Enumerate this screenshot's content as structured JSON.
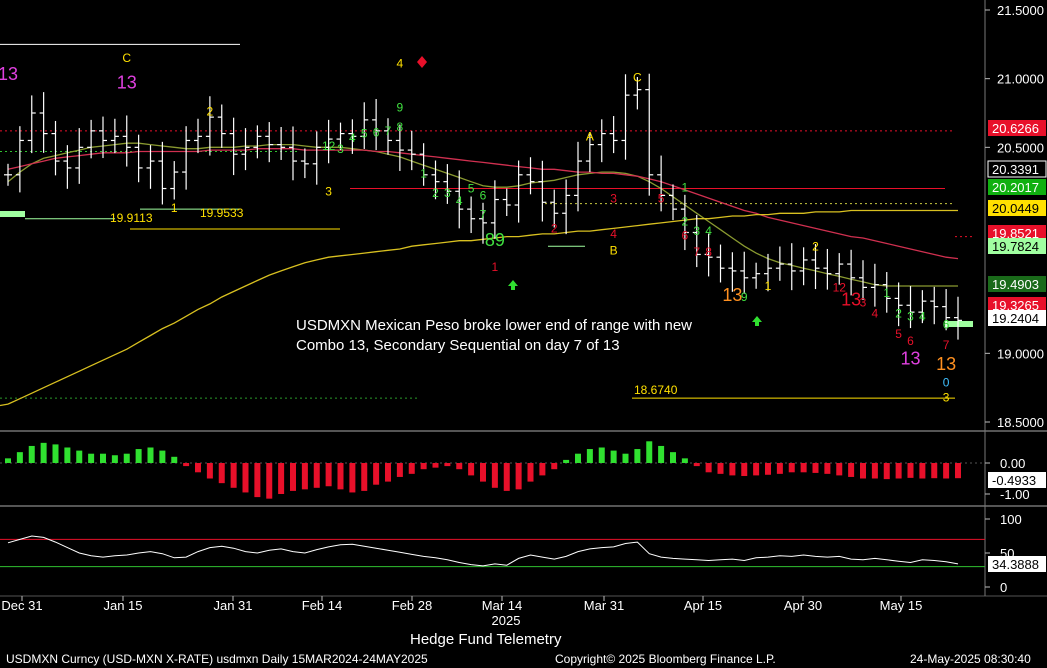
{
  "title": "Hedge Fund Telemetry",
  "footer": {
    "left": "USDMXN Curncy (USD-MXN X-RATE) usdmxn  Daily 15MAR2024-24MAY2025",
    "center": "Copyright© 2025 Bloomberg Finance L.P.",
    "right": "24-May-2025 08:30:40"
  },
  "annotation": {
    "line1": "USDMXN Mexican Peso broke lower end of range with new",
    "line2": "Combo 13, Secondary Sequential on day 7 of 13"
  },
  "chart_data": {
    "type": "candlestick",
    "x_ticks": [
      "Dec 31",
      "Jan 15",
      "Jan 31",
      "Feb 14",
      "Feb 28",
      "Mar 14",
      "Mar 31",
      "Apr 15",
      "Apr 30",
      "May 15"
    ],
    "x_year_label": "2025",
    "price_axis": {
      "ticks": [
        "21.5000",
        "21.0000",
        "20.5000",
        "19.0000",
        "18.5000"
      ],
      "ylim": [
        18.4,
        21.6
      ],
      "value_tags": [
        {
          "label": "20.6266",
          "value": 20.6266,
          "color": "#e8102a",
          "text": "#ffffff"
        },
        {
          "label": "20.3391",
          "value": 20.3391,
          "color": "#000000",
          "text": "#ffffff",
          "border": "#ffffff"
        },
        {
          "label": "20.2017",
          "value": 20.2017,
          "color": "#10b010",
          "text": "#ffffff"
        },
        {
          "label": "20.0449",
          "value": 20.0449,
          "color": "#ffe000",
          "text": "#000000"
        },
        {
          "label": "19.8521",
          "value": 19.8521,
          "color": "#e8102a",
          "text": "#ffffff"
        },
        {
          "label": "19.7824",
          "value": 19.7824,
          "color": "#a0ffa0",
          "text": "#000000"
        },
        {
          "label": "19.4903",
          "value": 19.4903,
          "color": "#1a6a1a",
          "text": "#ffffff"
        },
        {
          "label": "19.3265",
          "value": 19.3265,
          "color": "#e8102a",
          "text": "#ffffff"
        },
        {
          "label": "19.2404",
          "value": 19.2404,
          "color": "#ffffff",
          "text": "#000000"
        }
      ],
      "level_labels": [
        {
          "label": "19.9113",
          "value": 19.91
        },
        {
          "label": "19.9533",
          "value": 19.94
        },
        {
          "label": "18.6740",
          "value": 18.674
        }
      ]
    },
    "series": [
      {
        "name": "close",
        "values": [
          20.3,
          20.55,
          20.75,
          20.6,
          20.4,
          20.35,
          20.5,
          20.62,
          20.55,
          20.58,
          20.5,
          20.35,
          20.4,
          20.2,
          20.32,
          20.55,
          20.58,
          20.72,
          20.6,
          20.45,
          20.5,
          20.58,
          20.52,
          20.5,
          20.4,
          20.38,
          20.5,
          20.56,
          20.6,
          20.58,
          20.7,
          20.62,
          20.55,
          20.48,
          20.45,
          20.3,
          20.25,
          20.18,
          20.05,
          19.98,
          19.95,
          20.12,
          20.08,
          20.3,
          20.25,
          20.1,
          20.02,
          20.15,
          20.4,
          20.52,
          20.6,
          20.55,
          20.88,
          20.92,
          20.3,
          20.15,
          20.05,
          19.88,
          19.72,
          19.7,
          19.62,
          19.6,
          19.55,
          19.58,
          19.62,
          19.65,
          19.6,
          19.68,
          19.62,
          19.58,
          19.65,
          19.55,
          19.48,
          19.5,
          19.4,
          19.35,
          19.3,
          19.38,
          19.34,
          19.26,
          19.24
        ]
      },
      {
        "name": "MA-short",
        "values": [
          20.25,
          20.32,
          20.38,
          20.42,
          20.44,
          20.46,
          20.48,
          20.5,
          20.51,
          20.52,
          20.53,
          20.53,
          20.52,
          20.51,
          20.5,
          20.49,
          20.49,
          20.5,
          20.5,
          20.5,
          20.51,
          20.51,
          20.52,
          20.52,
          20.52,
          20.51,
          20.5,
          20.5,
          20.5,
          20.49,
          20.48,
          20.47,
          20.45,
          20.43,
          20.4,
          20.37,
          20.34,
          20.31,
          20.28,
          20.25,
          20.22,
          20.21,
          20.21,
          20.22,
          20.24,
          20.25,
          20.26,
          20.28,
          20.3,
          20.31,
          20.32,
          20.32,
          20.31,
          20.29,
          20.25,
          20.2,
          20.14,
          20.08,
          20.02,
          19.96,
          19.9,
          19.84,
          19.78,
          19.73,
          19.69,
          19.66,
          19.64,
          19.62,
          19.6,
          19.58,
          19.56,
          19.54,
          19.52,
          19.5,
          19.49,
          19.49,
          19.49,
          19.49,
          19.49,
          19.49,
          19.49
        ]
      },
      {
        "name": "MA-mid",
        "values": [
          20.34,
          20.36,
          20.38,
          20.4,
          20.42,
          20.43,
          20.44,
          20.45,
          20.46,
          20.46,
          20.46,
          20.47,
          20.47,
          20.47,
          20.47,
          20.47,
          20.47,
          20.48,
          20.48,
          20.48,
          20.48,
          20.49,
          20.49,
          20.49,
          20.49,
          20.48,
          20.48,
          20.48,
          20.48,
          20.48,
          20.48,
          20.47,
          20.47,
          20.46,
          20.45,
          20.44,
          20.43,
          20.42,
          20.41,
          20.4,
          20.39,
          20.38,
          20.37,
          20.36,
          20.35,
          20.34,
          20.34,
          20.33,
          20.32,
          20.32,
          20.31,
          20.31,
          20.3,
          20.29,
          20.27,
          20.25,
          20.22,
          20.19,
          20.16,
          20.13,
          20.1,
          20.07,
          20.04,
          20.02,
          19.99,
          19.97,
          19.95,
          19.93,
          19.91,
          19.89,
          19.87,
          19.85,
          19.84,
          19.82,
          19.8,
          19.78,
          19.76,
          19.74,
          19.72,
          19.7,
          19.69
        ]
      },
      {
        "name": "MA-long",
        "values": [
          18.63,
          18.67,
          18.71,
          18.75,
          18.79,
          18.83,
          18.87,
          18.91,
          18.95,
          18.99,
          19.03,
          19.08,
          19.13,
          19.18,
          19.22,
          19.27,
          19.32,
          19.36,
          19.41,
          19.45,
          19.49,
          19.53,
          19.57,
          19.6,
          19.63,
          19.66,
          19.68,
          19.7,
          19.71,
          19.72,
          19.73,
          19.74,
          19.75,
          19.76,
          19.78,
          19.79,
          19.8,
          19.81,
          19.82,
          19.82,
          19.83,
          19.84,
          19.85,
          19.85,
          19.86,
          19.87,
          19.87,
          19.88,
          19.89,
          19.89,
          19.9,
          19.91,
          19.92,
          19.93,
          19.94,
          19.95,
          19.96,
          19.97,
          19.98,
          19.98,
          19.99,
          20.0,
          20.0,
          20.01,
          20.01,
          20.02,
          20.02,
          20.02,
          20.03,
          20.03,
          20.03,
          20.04,
          20.04,
          20.04,
          20.04,
          20.04,
          20.04,
          20.04,
          20.04,
          20.04,
          20.04
        ]
      }
    ],
    "td_labels": [
      {
        "text": "13",
        "color": "#e040e0",
        "i": 0,
        "y": 20.99
      },
      {
        "text": "C",
        "color": "#ffe000",
        "i": 10,
        "y": 21.12
      },
      {
        "text": "13",
        "color": "#e040e0",
        "i": 10,
        "y": 20.93
      },
      {
        "text": "2",
        "color": "#ffe000",
        "i": 17,
        "y": 20.73
      },
      {
        "text": "1",
        "color": "#ffe000",
        "i": 14,
        "y": 20.03
      },
      {
        "text": "12",
        "color": "#40e040",
        "i": 27,
        "y": 20.48
      },
      {
        "text": "3",
        "color": "#40e040",
        "i": 28,
        "y": 20.46
      },
      {
        "text": "4",
        "color": "#40e040",
        "i": 29,
        "y": 20.54
      },
      {
        "text": "5",
        "color": "#40e040",
        "i": 30,
        "y": 20.57
      },
      {
        "text": "6",
        "color": "#40e040",
        "i": 31,
        "y": 20.58
      },
      {
        "text": "7",
        "color": "#40e040",
        "i": 32,
        "y": 20.59
      },
      {
        "text": "8",
        "color": "#40e040",
        "i": 33,
        "y": 20.62
      },
      {
        "text": "4",
        "color": "#ffe000",
        "i": 33,
        "y": 21.08
      },
      {
        "text": "9",
        "color": "#40e040",
        "i": 33,
        "y": 20.76
      },
      {
        "text": "3",
        "color": "#ffe000",
        "i": 27,
        "y": 20.15
      },
      {
        "text": "1",
        "color": "#40e040",
        "i": 35,
        "y": 20.28
      },
      {
        "text": "2",
        "color": "#40e040",
        "i": 36,
        "y": 20.14
      },
      {
        "text": "3",
        "color": "#40e040",
        "i": 37,
        "y": 20.14
      },
      {
        "text": "4",
        "color": "#40e040",
        "i": 38,
        "y": 20.08
      },
      {
        "text": "5",
        "color": "#40e040",
        "i": 39,
        "y": 20.17
      },
      {
        "text": "6",
        "color": "#40e040",
        "i": 40,
        "y": 20.12
      },
      {
        "text": "7",
        "color": "#40e040",
        "i": 40,
        "y": 19.98
      },
      {
        "text": "89",
        "color": "#40e040",
        "i": 41,
        "y": 19.78
      },
      {
        "text": "1",
        "color": "#e8102a",
        "i": 41,
        "y": 19.6
      },
      {
        "text": "2",
        "color": "#e8102a",
        "i": 46,
        "y": 19.88
      },
      {
        "text": "A",
        "color": "#ffe000",
        "i": 49,
        "y": 20.55
      },
      {
        "text": "3",
        "color": "#e8102a",
        "i": 51,
        "y": 20.1
      },
      {
        "text": "4",
        "color": "#e8102a",
        "i": 51,
        "y": 19.84
      },
      {
        "text": "B",
        "color": "#ffe000",
        "i": 51,
        "y": 19.72
      },
      {
        "text": "C",
        "color": "#ffe000",
        "i": 53,
        "y": 20.98
      },
      {
        "text": "5",
        "color": "#e8102a",
        "i": 55,
        "y": 20.1
      },
      {
        "text": "1",
        "color": "#40e040",
        "i": 57,
        "y": 20.18
      },
      {
        "text": "2",
        "color": "#40e040",
        "i": 57,
        "y": 19.93
      },
      {
        "text": "6",
        "color": "#e8102a",
        "i": 57,
        "y": 19.83
      },
      {
        "text": "3",
        "color": "#40e040",
        "i": 58,
        "y": 19.86
      },
      {
        "text": "4",
        "color": "#40e040",
        "i": 59,
        "y": 19.86
      },
      {
        "text": "7",
        "color": "#e8102a",
        "i": 58,
        "y": 19.71
      },
      {
        "text": "8",
        "color": "#e8102a",
        "i": 59,
        "y": 19.71
      },
      {
        "text": "13",
        "color": "#ff9020",
        "i": 61,
        "y": 19.38
      },
      {
        "text": "9",
        "color": "#40e040",
        "i": 62,
        "y": 19.38
      },
      {
        "text": "1",
        "color": "#ffe000",
        "i": 64,
        "y": 19.46
      },
      {
        "text": "2",
        "color": "#ffe000",
        "i": 68,
        "y": 19.75
      },
      {
        "text": "12",
        "color": "#e8102a",
        "i": 70,
        "y": 19.45
      },
      {
        "text": "13",
        "color": "#e8102a",
        "i": 71,
        "y": 19.35
      },
      {
        "text": "3",
        "color": "#e8102a",
        "i": 72,
        "y": 19.34
      },
      {
        "text": "4",
        "color": "#e8102a",
        "i": 73,
        "y": 19.26
      },
      {
        "text": "1",
        "color": "#40e040",
        "i": 74,
        "y": 19.41
      },
      {
        "text": "2",
        "color": "#40e040",
        "i": 75,
        "y": 19.26
      },
      {
        "text": "3",
        "color": "#40e040",
        "i": 76,
        "y": 19.24
      },
      {
        "text": "4",
        "color": "#40e040",
        "i": 77,
        "y": 19.24
      },
      {
        "text": "5",
        "color": "#e8102a",
        "i": 75,
        "y": 19.11
      },
      {
        "text": "6",
        "color": "#e8102a",
        "i": 76,
        "y": 19.06
      },
      {
        "text": "13",
        "color": "#e040e0",
        "i": 76,
        "y": 18.92
      },
      {
        "text": "6",
        "color": "#40e040",
        "i": 79,
        "y": 19.18
      },
      {
        "text": "7",
        "color": "#e8102a",
        "i": 79,
        "y": 19.03
      },
      {
        "text": "13",
        "color": "#ff9020",
        "i": 79,
        "y": 18.88
      },
      {
        "text": "0",
        "color": "#40c0ff",
        "i": 79,
        "y": 18.76
      },
      {
        "text": "3",
        "color": "#ffe000",
        "i": 79,
        "y": 18.65
      }
    ],
    "oscillator": {
      "name": "histogram",
      "ticks": [
        "0.00",
        "-1.00"
      ],
      "ylim": [
        -1.15,
        0.85
      ],
      "value_tag": "-0.4933",
      "values": [
        0.15,
        0.35,
        0.55,
        0.65,
        0.6,
        0.5,
        0.4,
        0.3,
        0.3,
        0.25,
        0.3,
        0.45,
        0.5,
        0.4,
        0.2,
        -0.1,
        -0.3,
        -0.5,
        -0.65,
        -0.8,
        -0.95,
        -1.1,
        -1.15,
        -1.0,
        -0.9,
        -0.85,
        -0.8,
        -0.75,
        -0.85,
        -0.95,
        -0.9,
        -0.7,
        -0.6,
        -0.45,
        -0.35,
        -0.2,
        -0.15,
        -0.1,
        -0.2,
        -0.4,
        -0.6,
        -0.8,
        -0.9,
        -0.85,
        -0.6,
        -0.4,
        -0.2,
        0.1,
        0.3,
        0.45,
        0.5,
        0.4,
        0.3,
        0.45,
        0.7,
        0.55,
        0.35,
        0.15,
        -0.1,
        -0.3,
        -0.35,
        -0.4,
        -0.42,
        -0.4,
        -0.38,
        -0.35,
        -0.3,
        -0.3,
        -0.32,
        -0.35,
        -0.4,
        -0.45,
        -0.5,
        -0.5,
        -0.52,
        -0.5,
        -0.48,
        -0.5,
        -0.49,
        -0.5,
        -0.49
      ]
    },
    "rsi": {
      "ticks": [
        "100",
        "50",
        "0"
      ],
      "ylim": [
        -5,
        105
      ],
      "overbought": 70,
      "oversold": 30,
      "value_tag": "34.3888",
      "values": [
        65,
        70,
        75,
        73,
        66,
        58,
        50,
        46,
        44,
        46,
        47,
        50,
        52,
        49,
        43,
        44,
        52,
        58,
        60,
        57,
        52,
        50,
        54,
        56,
        52,
        50,
        55,
        59,
        62,
        63,
        60,
        57,
        54,
        51,
        48,
        45,
        43,
        40,
        36,
        33,
        31,
        34,
        32,
        42,
        47,
        44,
        41,
        45,
        52,
        56,
        58,
        59,
        64,
        66,
        49,
        44,
        42,
        41,
        40,
        39,
        40,
        41,
        39,
        43,
        44,
        46,
        45,
        47,
        45,
        44,
        45,
        41,
        40,
        42,
        40,
        38,
        36,
        40,
        39,
        37,
        34
      ]
    }
  }
}
